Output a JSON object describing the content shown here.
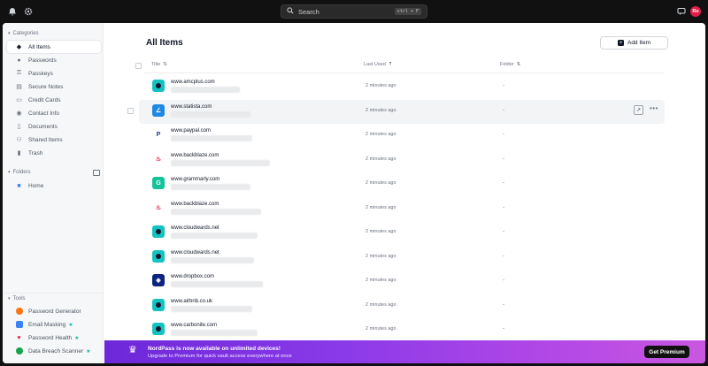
{
  "topbar": {
    "search_placeholder": "Search",
    "search_shortcut": "ctrl + F",
    "avatar_initials": "Ro"
  },
  "sidebar": {
    "categories_label": "Categories",
    "categories": [
      {
        "label": "All Items",
        "icon": "layers-icon",
        "active": true
      },
      {
        "label": "Passwords",
        "icon": "password-icon"
      },
      {
        "label": "Passkeys",
        "icon": "passkey-icon"
      },
      {
        "label": "Secure Notes",
        "icon": "note-icon"
      },
      {
        "label": "Credit Cards",
        "icon": "credit-card-icon"
      },
      {
        "label": "Contact Info",
        "icon": "contact-icon"
      },
      {
        "label": "Documents",
        "icon": "document-icon"
      },
      {
        "label": "Shared Items",
        "icon": "shared-icon"
      },
      {
        "label": "Trash",
        "icon": "trash-icon"
      }
    ],
    "folders_label": "Folders",
    "folders": [
      {
        "label": "Home",
        "icon": "folder-icon"
      }
    ],
    "tools_label": "Tools",
    "tools": [
      {
        "label": "Password Generator",
        "icon": "generator-icon",
        "color": "#f97316"
      },
      {
        "label": "Email Masking",
        "icon": "email-mask-icon",
        "color": "#3b82f6",
        "premium": true
      },
      {
        "label": "Password Health",
        "icon": "heart-icon",
        "color": "#e11d48",
        "premium": true
      },
      {
        "label": "Data Breach Scanner",
        "icon": "scanner-icon",
        "color": "#16a34a",
        "premium": true
      }
    ]
  },
  "main": {
    "title": "All Items",
    "add_button": "Add Item",
    "columns": {
      "title": "Title",
      "last_used": "Last Used",
      "folder": "Folder"
    },
    "rows": [
      {
        "site": "www.amcplus.com",
        "last_used": "2 minutes ago",
        "folder": "-",
        "logo": "amc-logo-icon",
        "logo_color": "#14c2c2",
        "logo_text": "•"
      },
      {
        "site": "www.statista.com",
        "last_used": "2 minutes ago",
        "folder": "-",
        "logo": "statista-logo-icon",
        "logo_color": "#1e88e5",
        "logo_text": "∠",
        "hover": true
      },
      {
        "site": "www.paypal.com",
        "last_used": "2 minutes ago",
        "folder": "-",
        "logo": "paypal-logo-icon",
        "logo_color": "#ffffff",
        "logo_text": "P"
      },
      {
        "site": "www.backblaze.com",
        "last_used": "2 minutes ago",
        "folder": "-",
        "logo": "backblaze-logo-icon",
        "logo_color": "#ffffff",
        "logo_text": "♨"
      },
      {
        "site": "www.grammarly.com",
        "last_used": "2 minutes ago",
        "folder": "-",
        "logo": "grammarly-logo-icon",
        "logo_color": "#15c39a",
        "logo_text": "G"
      },
      {
        "site": "www.backblaze.com",
        "last_used": "2 minutes ago",
        "folder": "-",
        "logo": "backblaze-logo-icon",
        "logo_color": "#ffffff",
        "logo_text": "♨"
      },
      {
        "site": "www.cloudwards.net",
        "last_used": "2 minutes ago",
        "folder": "-",
        "logo": "cloudwards-logo-icon",
        "logo_color": "#14c2c2",
        "logo_text": "•"
      },
      {
        "site": "www.cloudwards.net",
        "last_used": "2 minutes ago",
        "folder": "-",
        "logo": "cloudwards-logo-icon",
        "logo_color": "#14c2c2",
        "logo_text": "•"
      },
      {
        "site": "www.dropbox.com",
        "last_used": "2 minutes ago",
        "folder": "-",
        "logo": "dropbox-logo-icon",
        "logo_color": "#0d2481",
        "logo_text": "◈"
      },
      {
        "site": "www.airbnb.co.uk",
        "last_used": "2 minutes ago",
        "folder": "-",
        "logo": "airbnb-logo-icon",
        "logo_color": "#14c2c2",
        "logo_text": "•"
      },
      {
        "site": "www.carbonite.com",
        "last_used": "2 minutes ago",
        "folder": "-",
        "logo": "carbonite-logo-icon",
        "logo_color": "#14c2c2",
        "logo_text": "•"
      }
    ]
  },
  "banner": {
    "headline": "NordPass is now available on unlimited devices!",
    "subtext": "Upgrade to Premium for quick vault access everywhere at once",
    "button": "Get Premium"
  }
}
